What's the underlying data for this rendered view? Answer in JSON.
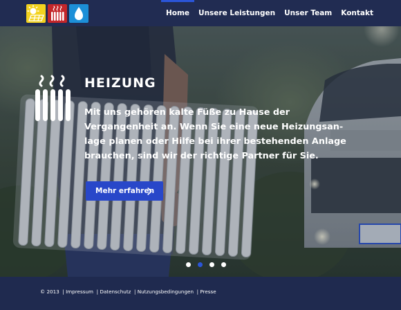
{
  "logo": {
    "icons": [
      "sun-solar-icon",
      "radiator-heating-icon",
      "water-drop-icon"
    ],
    "colors": [
      "#f3d21f",
      "#c4262a",
      "#1c8fd8"
    ]
  },
  "nav": {
    "items": [
      {
        "label": "Home",
        "active": true
      },
      {
        "label": "Unsere Leistungen",
        "active": false
      },
      {
        "label": "Unser Team",
        "active": false
      },
      {
        "label": "Kontakt",
        "active": false
      }
    ]
  },
  "hero": {
    "icon": "radiator-heat-icon",
    "title": "HEIZUNG",
    "text_lines": [
      "Mit uns gehören kalte Füße zu Hause der",
      "Vergangenheit an. Wenn Sie eine neue Heizungsan-",
      "lage planen oder Hilfe bei ihrer bestehenden Anlage",
      "brauchen, sind wir der richtige Partner für Sie."
    ],
    "button_label": "Mehr erfahren",
    "button_icon": "chevron-right-icon",
    "slides": 4,
    "active_slide": 2
  },
  "footer": {
    "copyright": "© 2013",
    "links": [
      "Impressum",
      "Datenschutz",
      "Nutzungsbedingungen",
      "Presse"
    ]
  },
  "colors": {
    "header_bg": "#212c52",
    "accent": "#2b55d8",
    "button": "#2847c9",
    "footer_bg": "#1f2a4f"
  }
}
